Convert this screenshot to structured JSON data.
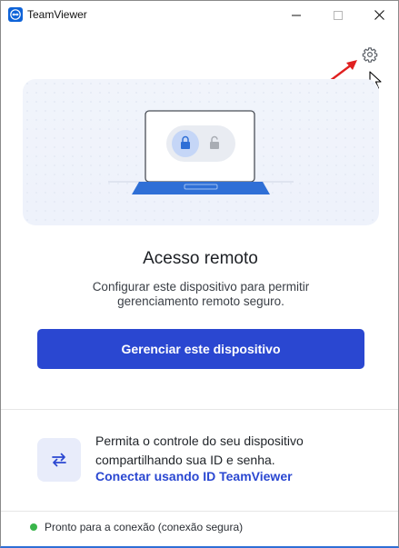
{
  "window": {
    "title": "TeamViewer",
    "icons": {
      "app": "teamviewer-logo-icon",
      "minimize": "minimize-icon",
      "maximize": "maximize-icon",
      "close": "close-icon"
    }
  },
  "toolbar": {
    "settings_icon": "gear-icon"
  },
  "main": {
    "heading": "Acesso remoto",
    "description": "Configurar este dispositivo para permitir gerenciamento remoto seguro.",
    "primary_button": "Gerenciar este dispositivo",
    "illustration": {
      "laptop_icon": "laptop-icon",
      "locked_icon": "lock-closed-icon",
      "unlocked_icon": "lock-open-icon"
    }
  },
  "connect": {
    "text": "Permita o controle do seu dispositivo compartilhando sua ID e senha.",
    "link": "Conectar usando ID TeamViewer",
    "icon": "swap-arrows-icon"
  },
  "status": {
    "text": "Pronto para a conexão (conexão segura)",
    "color": "#39b54a"
  },
  "colors": {
    "accent": "#2a47d1",
    "annotation": "#e02020"
  }
}
